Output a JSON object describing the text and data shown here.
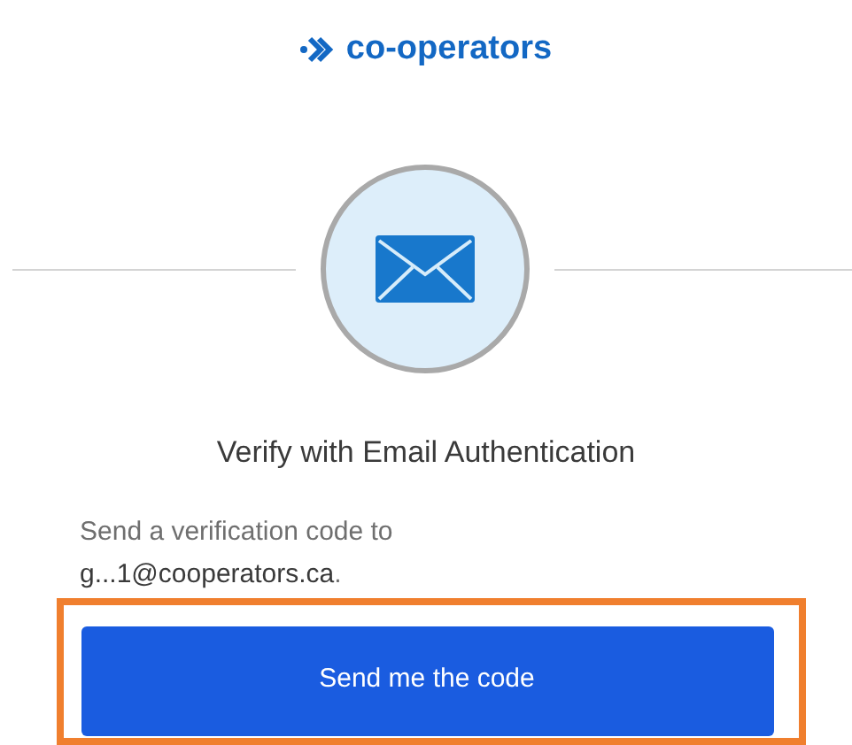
{
  "logo": {
    "text": "co-operators"
  },
  "heading": "Verify with Email Authentication",
  "message": "Send a verification code to **g...1@cooperators.ca**.",
  "highlight": {
    "on": true
  },
  "button": {
    "label": "Send me the code"
  }
}
